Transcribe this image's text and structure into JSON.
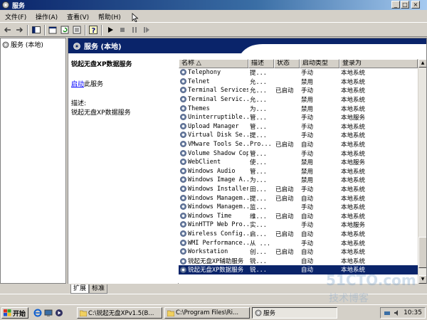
{
  "window": {
    "title": "服务"
  },
  "menu": [
    "文件(F)",
    "操作(A)",
    "查看(V)",
    "帮助(H)"
  ],
  "tree": {
    "root": "服务 (本地)"
  },
  "panel": {
    "header": "服务 (本地)"
  },
  "description": {
    "service_name": "锐起无盘XP数据服务",
    "start_link": "启动",
    "start_suffix": "此服务",
    "desc_label": "描述:",
    "desc_text": "锐起无盘XP数据服务"
  },
  "columns": [
    "名称",
    "描述",
    "状态",
    "启动类型",
    "登录为"
  ],
  "services": [
    {
      "name": "Telephony",
      "desc": "提...",
      "status": "",
      "startup": "手动",
      "logon": "本地系统"
    },
    {
      "name": "Telnet",
      "desc": "允...",
      "status": "",
      "startup": "禁用",
      "logon": "本地系统"
    },
    {
      "name": "Terminal Services",
      "desc": "允...",
      "status": "已启动",
      "startup": "手动",
      "logon": "本地系统"
    },
    {
      "name": "Terminal Servic...",
      "desc": "允...",
      "status": "",
      "startup": "禁用",
      "logon": "本地系统"
    },
    {
      "name": "Themes",
      "desc": "为...",
      "status": "",
      "startup": "禁用",
      "logon": "本地系统"
    },
    {
      "name": "Uninterruptible...",
      "desc": "管...",
      "status": "",
      "startup": "手动",
      "logon": "本地服务"
    },
    {
      "name": "Upload Manager",
      "desc": "管...",
      "status": "",
      "startup": "手动",
      "logon": "本地系统"
    },
    {
      "name": "Virtual Disk Se...",
      "desc": "提...",
      "status": "",
      "startup": "手动",
      "logon": "本地系统"
    },
    {
      "name": "VMware Tools Se...",
      "desc": "Pro...",
      "status": "已启动",
      "startup": "自动",
      "logon": "本地系统"
    },
    {
      "name": "Volume Shadow Copy",
      "desc": "管...",
      "status": "",
      "startup": "手动",
      "logon": "本地系统"
    },
    {
      "name": "WebClient",
      "desc": "使...",
      "status": "",
      "startup": "禁用",
      "logon": "本地服务"
    },
    {
      "name": "Windows Audio",
      "desc": "管...",
      "status": "",
      "startup": "禁用",
      "logon": "本地系统"
    },
    {
      "name": "Windows Image A...",
      "desc": "为...",
      "status": "",
      "startup": "禁用",
      "logon": "本地系统"
    },
    {
      "name": "Windows Installer",
      "desc": "田...",
      "status": "已启动",
      "startup": "手动",
      "logon": "本地系统"
    },
    {
      "name": "Windows Managem...",
      "desc": "提...",
      "status": "已启动",
      "startup": "自动",
      "logon": "本地系统"
    },
    {
      "name": "Windows Managem...",
      "desc": "监...",
      "status": "",
      "startup": "手动",
      "logon": "本地系统"
    },
    {
      "name": "Windows Time",
      "desc": "维...",
      "status": "已启动",
      "startup": "自动",
      "logon": "本地系统"
    },
    {
      "name": "WinHTTP Web Pro...",
      "desc": "实...",
      "status": "",
      "startup": "手动",
      "logon": "本地服务"
    },
    {
      "name": "Wireless Config...",
      "desc": "启...",
      "status": "已启动",
      "startup": "自动",
      "logon": "本地系统"
    },
    {
      "name": "WMI Performance...",
      "desc": "从 ...",
      "status": "",
      "startup": "手动",
      "logon": "本地系统"
    },
    {
      "name": "Workstation",
      "desc": "创...",
      "status": "已启动",
      "startup": "自动",
      "logon": "本地系统"
    },
    {
      "name": "锐起无盘XP辅助服务",
      "desc": "锐...",
      "status": "",
      "startup": "自动",
      "logon": "本地系统"
    },
    {
      "name": "锐起无盘XP数据服务",
      "desc": "锐...",
      "status": "",
      "startup": "自动",
      "logon": "本地系统",
      "selected": true
    }
  ],
  "tabs": [
    "扩展",
    "标准"
  ],
  "taskbar": {
    "start": "开始",
    "tasks": [
      "C:\\锐起无盘XPv1.5(B...",
      "C:\\Program Files\\Ri...",
      "服务"
    ],
    "clock": "10:35"
  },
  "watermark": {
    "line1": "51CTO.com",
    "line2": "技术博客"
  },
  "colors": {
    "titlebar": "#0a246a",
    "selection": "#0a246a",
    "chrome": "#d4d0c8"
  }
}
